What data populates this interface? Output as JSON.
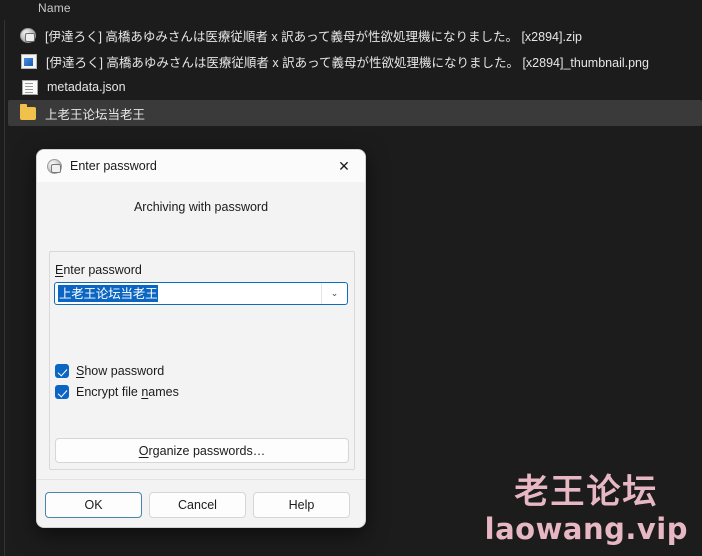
{
  "explorer": {
    "column_header": "Name",
    "files": [
      {
        "icon": "zip-archive-icon",
        "name": "[伊達ろく] 高橋あゆみさんは医療従順者 x 訳あって義母が性欲処理機になりました。 [x2894].zip",
        "selected": false
      },
      {
        "icon": "png-image-icon",
        "name": "[伊達ろく] 高橋あゆみさんは医療従順者 x 訳あって義母が性欲処理機になりました。 [x2894]_thumbnail.png",
        "selected": false
      },
      {
        "icon": "json-file-icon",
        "name": "metadata.json",
        "selected": false
      },
      {
        "icon": "folder-icon",
        "name": "上老王论坛当老王",
        "selected": true
      }
    ]
  },
  "dialog": {
    "title": "Enter password",
    "close_label": "✕",
    "subtitle": "Archiving with password",
    "password_label_pre": "E",
    "password_label_acc": "",
    "password_label": "Enter password",
    "password_value": "上老王论坛当老王",
    "dropdown_arrow": "⌄",
    "checkboxes": [
      {
        "label": "Show password",
        "checked": true
      },
      {
        "label": "Encrypt file names",
        "checked": true
      }
    ],
    "organize_label": "Organize passwords…",
    "buttons": {
      "ok": "OK",
      "cancel": "Cancel",
      "help": "Help"
    }
  },
  "watermark": {
    "cn": "老王论坛",
    "en": "laowang.vip",
    "color": "#e7b8c3"
  },
  "colors": {
    "window_bg": "#1c1c1c",
    "selected_row": "#3a3a3a",
    "dialog_bg": "#f3f3f3",
    "accent": "#0b66c3",
    "folder": "#f0c24b"
  }
}
